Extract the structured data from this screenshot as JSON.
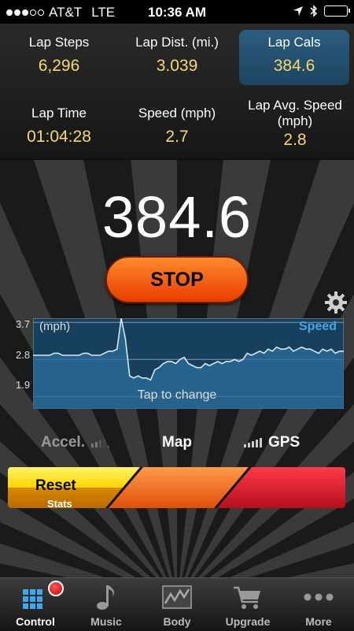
{
  "status_bar": {
    "carrier": "AT&T",
    "network": "LTE",
    "time": "10:36 AM",
    "signal_bars_filled": 3,
    "signal_bars_total": 5
  },
  "stats": [
    {
      "label": "Lap Steps",
      "value": "6,296",
      "selected": false
    },
    {
      "label": "Lap Dist. (mi.)",
      "value": "3.039",
      "selected": false
    },
    {
      "label": "Lap Cals",
      "value": "384.6",
      "selected": true
    },
    {
      "label": "Lap Time",
      "value": "01:04:28",
      "selected": false
    },
    {
      "label": "Speed (mph)",
      "value": "2.7",
      "selected": false
    },
    {
      "label": "Lap Avg. Speed (mph)",
      "value": "2.8",
      "selected": false
    }
  ],
  "main": {
    "big_value": "384.6",
    "stop_label": "STOP"
  },
  "chart_data": {
    "type": "area",
    "unit_label": "(mph)",
    "series_label": "Speed",
    "hint": "Tap to change",
    "y_ticks": [
      "3.7",
      "2.8",
      "1.9"
    ],
    "ylim": [
      1.6,
      3.8
    ],
    "grid": true,
    "series": [
      {
        "name": "Speed",
        "values": [
          2.9,
          2.9,
          2.9,
          2.9,
          2.9,
          2.95,
          2.95,
          2.9,
          2.9,
          2.9,
          2.9,
          2.9,
          2.95,
          2.95,
          2.9,
          2.9,
          2.9,
          2.95,
          3.0,
          3.0,
          3.05,
          3.8,
          3.3,
          2.4,
          2.35,
          2.4,
          2.35,
          2.35,
          2.3,
          2.55,
          2.6,
          2.7,
          2.75,
          2.75,
          2.7,
          2.8,
          2.85,
          2.7,
          2.65,
          2.6,
          2.6,
          2.7,
          2.65,
          2.7,
          2.75,
          2.7,
          2.75,
          2.75,
          2.8,
          2.75,
          2.8,
          2.95,
          2.9,
          2.95,
          3.0,
          2.95,
          3.05,
          3.0,
          3.1,
          3.05,
          3.05,
          3.1,
          3.0,
          3.05,
          3.1,
          3.05,
          3.05,
          3.0,
          2.95,
          3.05,
          3.0,
          3.05,
          2.95,
          3.0,
          3.0
        ]
      }
    ]
  },
  "modes": {
    "accel": "Accel.",
    "map": "Map",
    "gps": "GPS"
  },
  "slider": {
    "reset": "Reset",
    "stats": "Stats"
  },
  "tabs": [
    {
      "label": "Control",
      "icon": "control-grid-icon",
      "active": true
    },
    {
      "label": "Music",
      "icon": "music-note-icon",
      "active": false
    },
    {
      "label": "Body",
      "icon": "body-chart-icon",
      "active": false
    },
    {
      "label": "Upgrade",
      "icon": "cart-icon",
      "active": false
    },
    {
      "label": "More",
      "icon": "more-dots-icon",
      "active": false
    }
  ],
  "colors": {
    "value_yellow": "#f6d96a",
    "selected_blue": "#24506e",
    "stop_orange": "#f25a0c",
    "chart_blue": "#1d4a6e",
    "speed_blue": "#4aa3e6",
    "reset_yellow": "#ffe21a",
    "slider_orange": "#f36a1c",
    "slider_red": "#d2182a"
  }
}
